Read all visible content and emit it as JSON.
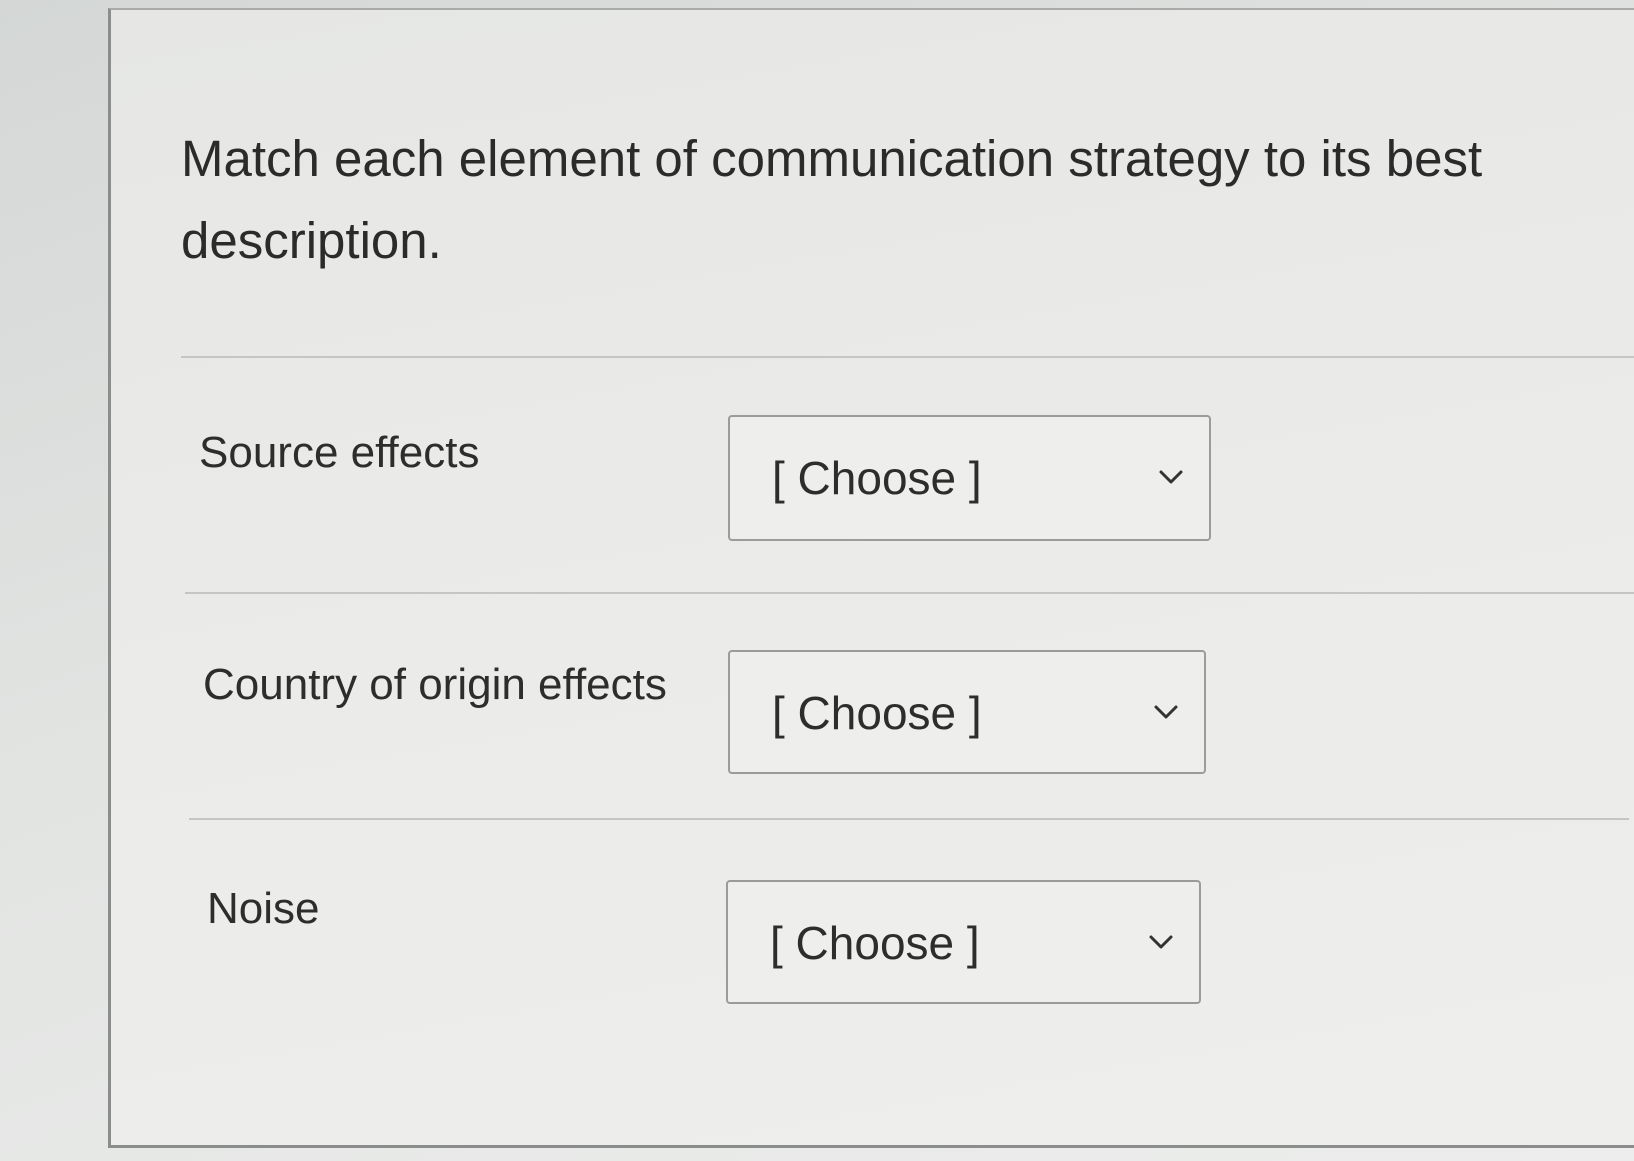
{
  "question": {
    "text": "Match each element of communication strategy to its best description."
  },
  "rows": [
    {
      "label": "Source effects",
      "selected": "[ Choose ]",
      "icon": "chevron-down-icon"
    },
    {
      "label": "Country of origin effects",
      "selected": "[ Choose ]",
      "icon": "chevron-down-icon"
    },
    {
      "label": "Noise",
      "selected": "[ Choose ]",
      "icon": "chevron-down-icon"
    }
  ]
}
